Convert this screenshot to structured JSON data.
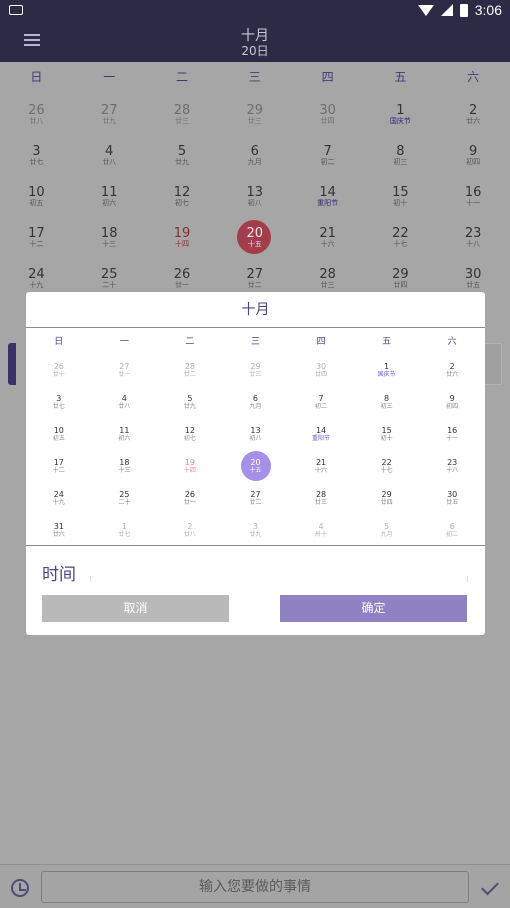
{
  "status": {
    "time": "3:06"
  },
  "header": {
    "month": "十月",
    "day": "20日"
  },
  "weekdays": [
    "日",
    "一",
    "二",
    "三",
    "四",
    "五",
    "六"
  ],
  "bg_calendar": [
    [
      {
        "n": "26",
        "l": "廿八",
        "s": "dim"
      },
      {
        "n": "27",
        "l": "廿九",
        "s": "dim"
      },
      {
        "n": "28",
        "l": "廿三",
        "s": "dim"
      },
      {
        "n": "29",
        "l": "廿三",
        "s": "dim"
      },
      {
        "n": "30",
        "l": "廿四",
        "s": "dim"
      },
      {
        "n": "1",
        "l": "国庆节",
        "s": "hol"
      },
      {
        "n": "2",
        "l": "廿六",
        "s": ""
      }
    ],
    [
      {
        "n": "3",
        "l": "廿七",
        "s": ""
      },
      {
        "n": "4",
        "l": "廿八",
        "s": ""
      },
      {
        "n": "5",
        "l": "廿九",
        "s": ""
      },
      {
        "n": "6",
        "l": "九月",
        "s": ""
      },
      {
        "n": "7",
        "l": "初二",
        "s": ""
      },
      {
        "n": "8",
        "l": "初三",
        "s": ""
      },
      {
        "n": "9",
        "l": "初四",
        "s": ""
      }
    ],
    [
      {
        "n": "10",
        "l": "初五",
        "s": ""
      },
      {
        "n": "11",
        "l": "初六",
        "s": ""
      },
      {
        "n": "12",
        "l": "初七",
        "s": ""
      },
      {
        "n": "13",
        "l": "初八",
        "s": ""
      },
      {
        "n": "14",
        "l": "重阳节",
        "s": "hol"
      },
      {
        "n": "15",
        "l": "初十",
        "s": ""
      },
      {
        "n": "16",
        "l": "十一",
        "s": ""
      }
    ],
    [
      {
        "n": "17",
        "l": "十二",
        "s": ""
      },
      {
        "n": "18",
        "l": "十三",
        "s": ""
      },
      {
        "n": "19",
        "l": "十四",
        "s": "red"
      },
      {
        "n": "20",
        "l": "十五",
        "s": "sel"
      },
      {
        "n": "21",
        "l": "十六",
        "s": ""
      },
      {
        "n": "22",
        "l": "十七",
        "s": ""
      },
      {
        "n": "23",
        "l": "十八",
        "s": ""
      }
    ],
    [
      {
        "n": "24",
        "l": "十九",
        "s": ""
      },
      {
        "n": "25",
        "l": "二十",
        "s": ""
      },
      {
        "n": "26",
        "l": "廿一",
        "s": ""
      },
      {
        "n": "27",
        "l": "廿二",
        "s": ""
      },
      {
        "n": "28",
        "l": "廿三",
        "s": ""
      },
      {
        "n": "29",
        "l": "廿四",
        "s": ""
      },
      {
        "n": "30",
        "l": "廿五",
        "s": ""
      }
    ]
  ],
  "dialog": {
    "title": "十月",
    "rows": [
      [
        {
          "n": "26",
          "l": "廿十",
          "s": "dim"
        },
        {
          "n": "27",
          "l": "廿一",
          "s": "dim"
        },
        {
          "n": "28",
          "l": "廿二",
          "s": "dim"
        },
        {
          "n": "29",
          "l": "廿三",
          "s": "dim"
        },
        {
          "n": "30",
          "l": "廿四",
          "s": "dim"
        },
        {
          "n": "1",
          "l": "国庆节",
          "s": "hol"
        },
        {
          "n": "2",
          "l": "廿六",
          "s": ""
        }
      ],
      [
        {
          "n": "3",
          "l": "廿七",
          "s": ""
        },
        {
          "n": "4",
          "l": "廿八",
          "s": ""
        },
        {
          "n": "5",
          "l": "廿九",
          "s": ""
        },
        {
          "n": "6",
          "l": "九月",
          "s": ""
        },
        {
          "n": "7",
          "l": "初二",
          "s": ""
        },
        {
          "n": "8",
          "l": "初三",
          "s": ""
        },
        {
          "n": "9",
          "l": "初四",
          "s": ""
        }
      ],
      [
        {
          "n": "10",
          "l": "初五",
          "s": ""
        },
        {
          "n": "11",
          "l": "初六",
          "s": ""
        },
        {
          "n": "12",
          "l": "初七",
          "s": ""
        },
        {
          "n": "13",
          "l": "初八",
          "s": ""
        },
        {
          "n": "14",
          "l": "重阳节",
          "s": "hol"
        },
        {
          "n": "15",
          "l": "初十",
          "s": ""
        },
        {
          "n": "16",
          "l": "十一",
          "s": ""
        }
      ],
      [
        {
          "n": "17",
          "l": "十二",
          "s": ""
        },
        {
          "n": "18",
          "l": "十三",
          "s": ""
        },
        {
          "n": "19",
          "l": "十四",
          "s": "red"
        },
        {
          "n": "20",
          "l": "十五",
          "s": "sel"
        },
        {
          "n": "21",
          "l": "十六",
          "s": ""
        },
        {
          "n": "22",
          "l": "十七",
          "s": ""
        },
        {
          "n": "23",
          "l": "十八",
          "s": ""
        }
      ],
      [
        {
          "n": "24",
          "l": "十九",
          "s": ""
        },
        {
          "n": "25",
          "l": "二十",
          "s": ""
        },
        {
          "n": "26",
          "l": "廿一",
          "s": ""
        },
        {
          "n": "27",
          "l": "廿二",
          "s": ""
        },
        {
          "n": "28",
          "l": "廿三",
          "s": ""
        },
        {
          "n": "29",
          "l": "廿四",
          "s": ""
        },
        {
          "n": "30",
          "l": "廿五",
          "s": ""
        }
      ],
      [
        {
          "n": "31",
          "l": "廿六",
          "s": ""
        },
        {
          "n": "1",
          "l": "廿七",
          "s": "dim"
        },
        {
          "n": "2",
          "l": "廿八",
          "s": "dim"
        },
        {
          "n": "3",
          "l": "廿九",
          "s": "dim"
        },
        {
          "n": "4",
          "l": "卅十",
          "s": "dim"
        },
        {
          "n": "5",
          "l": "九月",
          "s": "dim"
        },
        {
          "n": "6",
          "l": "初二",
          "s": "dim"
        }
      ]
    ],
    "time_label": "时间",
    "cancel_label": "取消",
    "ok_label": "确定"
  },
  "bottom": {
    "placeholder": "输入您要做的事情"
  },
  "colors": {
    "appbar": "#2d2a45",
    "accent": "#8e82c2",
    "selected": "#a58fe8",
    "holiday": "#6b5fd1"
  },
  "icons": [
    "keyboard-icon",
    "wifi-icon",
    "signal-icon",
    "battery-icon",
    "menu-icon",
    "alarm-icon",
    "check-icon"
  ]
}
